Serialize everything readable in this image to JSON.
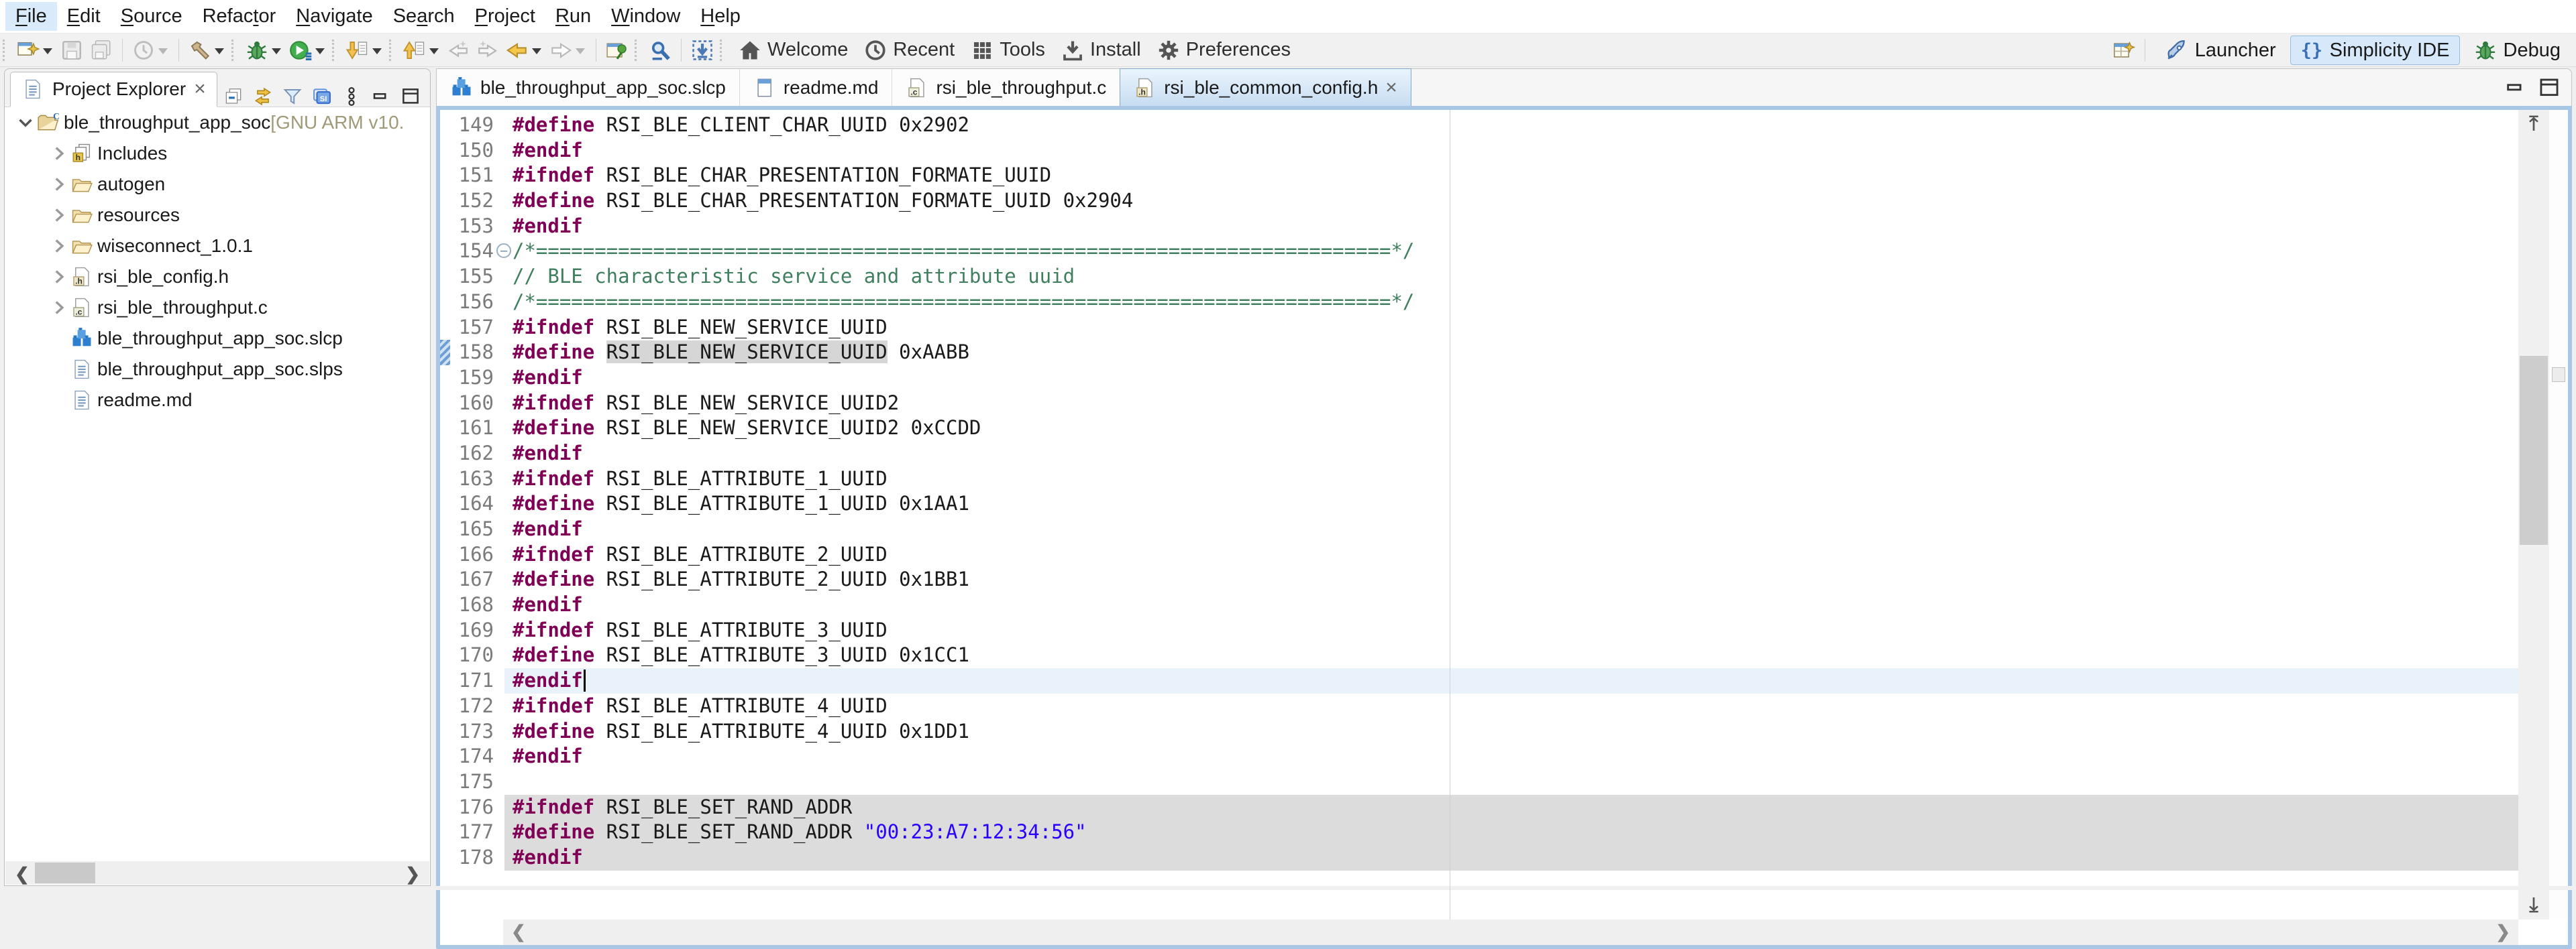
{
  "colors": {
    "directive": "#7f0055",
    "comment": "#3f7f5f",
    "string": "#2a00ff",
    "line_number": "#7b7b7b",
    "current_line_bg": "#e9f2fb",
    "selection_bg": "#dcdcdc",
    "occurrence_bg": "#d6d6d6",
    "active_tab_border": "#84a9cc",
    "editor_frame": "#a9c7e4",
    "perspective_active_bg": "#d6e8f9"
  },
  "menu": {
    "items": [
      {
        "label": "File",
        "mnemonic": 0,
        "highlighted": true
      },
      {
        "label": "Edit",
        "mnemonic": 0
      },
      {
        "label": "Source",
        "mnemonic": 0
      },
      {
        "label": "Refactor",
        "mnemonic": 5
      },
      {
        "label": "Navigate",
        "mnemonic": 0
      },
      {
        "label": "Search",
        "mnemonic": 2
      },
      {
        "label": "Project",
        "mnemonic": 0
      },
      {
        "label": "Run",
        "mnemonic": 0
      },
      {
        "label": "Window",
        "mnemonic": 0
      },
      {
        "label": "Help",
        "mnemonic": 0
      }
    ]
  },
  "toolbar": {
    "buttons": [
      {
        "type": "handle"
      },
      {
        "name": "new-wizard",
        "icon": "new-wizard",
        "dropdown": true
      },
      {
        "name": "save",
        "icon": "save",
        "disabled": true
      },
      {
        "name": "save-all",
        "icon": "save-all",
        "disabled": true
      },
      {
        "type": "sep"
      },
      {
        "name": "launch-history",
        "icon": "clock-disabled",
        "dropdown": true,
        "dropdown_disabled": true
      },
      {
        "type": "sep"
      },
      {
        "name": "build",
        "icon": "hammer",
        "dropdown": true
      },
      {
        "type": "handle"
      },
      {
        "name": "debug",
        "icon": "bug",
        "dropdown": true
      },
      {
        "name": "run",
        "icon": "run",
        "dropdown": true
      },
      {
        "type": "handle"
      },
      {
        "name": "next-annotation",
        "icon": "down-arrow-doc",
        "dropdown": true
      },
      {
        "type": "handle"
      },
      {
        "name": "previous-annotation",
        "icon": "up-arrow-doc",
        "dropdown": true
      },
      {
        "name": "last-edit-location",
        "icon": "edit-back",
        "disabled": true
      },
      {
        "name": "next-edit-location",
        "icon": "edit-forward",
        "disabled": true
      },
      {
        "name": "back",
        "icon": "back-arrow",
        "dropdown": true
      },
      {
        "name": "forward",
        "icon": "forward-arrow",
        "disabled": true,
        "dropdown": true,
        "dropdown_disabled": true
      },
      {
        "type": "sep"
      },
      {
        "name": "pin-editor",
        "icon": "pin-editor"
      },
      {
        "type": "handle"
      },
      {
        "name": "microscope",
        "icon": "microscope"
      },
      {
        "type": "sep"
      },
      {
        "name": "flash-programmer",
        "icon": "flash-programmer"
      },
      {
        "type": "handle"
      }
    ],
    "quick_access": [
      {
        "label": "Welcome",
        "icon": "home"
      },
      {
        "label": "Recent",
        "icon": "clock"
      },
      {
        "label": "Tools",
        "icon": "grid"
      },
      {
        "label": "Install",
        "icon": "download"
      },
      {
        "label": "Preferences",
        "icon": "gear"
      }
    ],
    "perspective_bar": {
      "open_perspective_icon": "open-perspective",
      "perspectives": [
        {
          "label": "Launcher",
          "icon": "rocket",
          "active": false
        },
        {
          "label": "Simplicity IDE",
          "icon": "braces",
          "active": true
        },
        {
          "label": "Debug",
          "icon": "bug",
          "active": false
        }
      ]
    }
  },
  "explorer": {
    "title": "Project Explorer",
    "close_glyph": "×",
    "header_icons": [
      "collapse-all",
      "link-editor",
      "filter",
      "si-stack",
      "view-menu",
      "minimize",
      "maximize"
    ],
    "tree": [
      {
        "label": "ble_throughput_app_soc",
        "suffix": " [GNU ARM v10.",
        "icon": "project",
        "depth": 0,
        "arrow": "expanded"
      },
      {
        "label": "Includes",
        "icon": "includes",
        "depth": 1,
        "arrow": "collapsed"
      },
      {
        "label": "autogen",
        "icon": "folder",
        "depth": 1,
        "arrow": "collapsed"
      },
      {
        "label": "resources",
        "icon": "folder",
        "depth": 1,
        "arrow": "collapsed"
      },
      {
        "label": "wiseconnect_1.0.1",
        "icon": "folder",
        "depth": 1,
        "arrow": "collapsed"
      },
      {
        "label": "rsi_ble_config.h",
        "icon": "hfile",
        "depth": 1,
        "arrow": "collapsed"
      },
      {
        "label": "rsi_ble_throughput.c",
        "icon": "cfile",
        "depth": 1,
        "arrow": "collapsed"
      },
      {
        "label": "ble_throughput_app_soc.slcp",
        "icon": "slcp",
        "depth": 1,
        "arrow": "none"
      },
      {
        "label": "ble_throughput_app_soc.slps",
        "icon": "doc",
        "depth": 1,
        "arrow": "none"
      },
      {
        "label": "readme.md",
        "icon": "doc",
        "depth": 1,
        "arrow": "none"
      }
    ]
  },
  "editor_tabs": [
    {
      "label": "ble_throughput_app_soc.slcp",
      "icon": "slcp",
      "active": false
    },
    {
      "label": "readme.md",
      "icon": "mdfile",
      "active": false
    },
    {
      "label": "rsi_ble_throughput.c",
      "icon": "cfile",
      "active": false
    },
    {
      "label": "rsi_ble_common_config.h",
      "icon": "hfile",
      "active": true,
      "close_glyph": "×"
    }
  ],
  "editor": {
    "lines": [
      {
        "n": "149",
        "tokens": [
          [
            "d",
            "#define"
          ],
          [
            "p",
            " RSI_BLE_CLIENT_CHAR_UUID 0x2902"
          ]
        ]
      },
      {
        "n": "150",
        "tokens": [
          [
            "d",
            "#endif"
          ]
        ]
      },
      {
        "n": "151",
        "tokens": [
          [
            "d",
            "#ifndef"
          ],
          [
            "p",
            " RSI_BLE_CHAR_PRESENTATION_FORMATE_UUID"
          ]
        ]
      },
      {
        "n": "152",
        "tokens": [
          [
            "d",
            "#define"
          ],
          [
            "p",
            " RSI_BLE_CHAR_PRESENTATION_FORMATE_UUID 0x2904"
          ]
        ]
      },
      {
        "n": "153",
        "tokens": [
          [
            "d",
            "#endif"
          ]
        ]
      },
      {
        "n": "154",
        "fold": true,
        "tokens": [
          [
            "c",
            "/*=========================================================================*/"
          ]
        ]
      },
      {
        "n": "155",
        "tokens": [
          [
            "c",
            "// BLE characteristic service and attribute uuid"
          ]
        ]
      },
      {
        "n": "156",
        "tokens": [
          [
            "c",
            "/*=========================================================================*/"
          ]
        ]
      },
      {
        "n": "157",
        "tokens": [
          [
            "d",
            "#ifndef"
          ],
          [
            "p",
            " RSI_BLE_NEW_SERVICE_UUID"
          ]
        ]
      },
      {
        "n": "158",
        "marker": true,
        "tokens": [
          [
            "d",
            "#define"
          ],
          [
            "p",
            " "
          ],
          [
            "h",
            "RSI_BLE_NEW_SERVICE_UUID"
          ],
          [
            "p",
            " 0xAABB"
          ]
        ]
      },
      {
        "n": "159",
        "tokens": [
          [
            "d",
            "#endif"
          ]
        ]
      },
      {
        "n": "160",
        "tokens": [
          [
            "d",
            "#ifndef"
          ],
          [
            "p",
            " RSI_BLE_NEW_SERVICE_UUID2"
          ]
        ]
      },
      {
        "n": "161",
        "tokens": [
          [
            "d",
            "#define"
          ],
          [
            "p",
            " RSI_BLE_NEW_SERVICE_UUID2 0xCCDD"
          ]
        ]
      },
      {
        "n": "162",
        "tokens": [
          [
            "d",
            "#endif"
          ]
        ]
      },
      {
        "n": "163",
        "tokens": [
          [
            "d",
            "#ifndef"
          ],
          [
            "p",
            " RSI_BLE_ATTRIBUTE_1_UUID"
          ]
        ]
      },
      {
        "n": "164",
        "tokens": [
          [
            "d",
            "#define"
          ],
          [
            "p",
            " RSI_BLE_ATTRIBUTE_1_UUID 0x1AA1"
          ]
        ]
      },
      {
        "n": "165",
        "tokens": [
          [
            "d",
            "#endif"
          ]
        ]
      },
      {
        "n": "166",
        "tokens": [
          [
            "d",
            "#ifndef"
          ],
          [
            "p",
            " RSI_BLE_ATTRIBUTE_2_UUID"
          ]
        ]
      },
      {
        "n": "167",
        "tokens": [
          [
            "d",
            "#define"
          ],
          [
            "p",
            " RSI_BLE_ATTRIBUTE_2_UUID 0x1BB1"
          ]
        ]
      },
      {
        "n": "168",
        "tokens": [
          [
            "d",
            "#endif"
          ]
        ]
      },
      {
        "n": "169",
        "tokens": [
          [
            "d",
            "#ifndef"
          ],
          [
            "p",
            " RSI_BLE_ATTRIBUTE_3_UUID"
          ]
        ]
      },
      {
        "n": "170",
        "tokens": [
          [
            "d",
            "#define"
          ],
          [
            "p",
            " RSI_BLE_ATTRIBUTE_3_UUID 0x1CC1"
          ]
        ]
      },
      {
        "n": "171",
        "bg": "current",
        "caret": true,
        "tokens": [
          [
            "d",
            "#endif"
          ]
        ]
      },
      {
        "n": "172",
        "tokens": [
          [
            "d",
            "#ifndef"
          ],
          [
            "p",
            " RSI_BLE_ATTRIBUTE_4_UUID"
          ]
        ]
      },
      {
        "n": "173",
        "tokens": [
          [
            "d",
            "#define"
          ],
          [
            "p",
            " RSI_BLE_ATTRIBUTE_4_UUID 0x1DD1"
          ]
        ]
      },
      {
        "n": "174",
        "tokens": [
          [
            "d",
            "#endif"
          ]
        ]
      },
      {
        "n": "175",
        "tokens": []
      },
      {
        "n": "176",
        "bg": "select",
        "tokens": [
          [
            "d",
            "#ifndef"
          ],
          [
            "p",
            " RSI_BLE_SET_RAND_ADDR"
          ]
        ]
      },
      {
        "n": "177",
        "bg": "select",
        "tokens": [
          [
            "d",
            "#define"
          ],
          [
            "p",
            " RSI_BLE_SET_RAND_ADDR "
          ],
          [
            "s",
            "\"00:23:A7:12:34:56\""
          ]
        ]
      },
      {
        "n": "178",
        "bg": "select",
        "tokens": [
          [
            "d",
            "#endif"
          ]
        ]
      }
    ]
  }
}
